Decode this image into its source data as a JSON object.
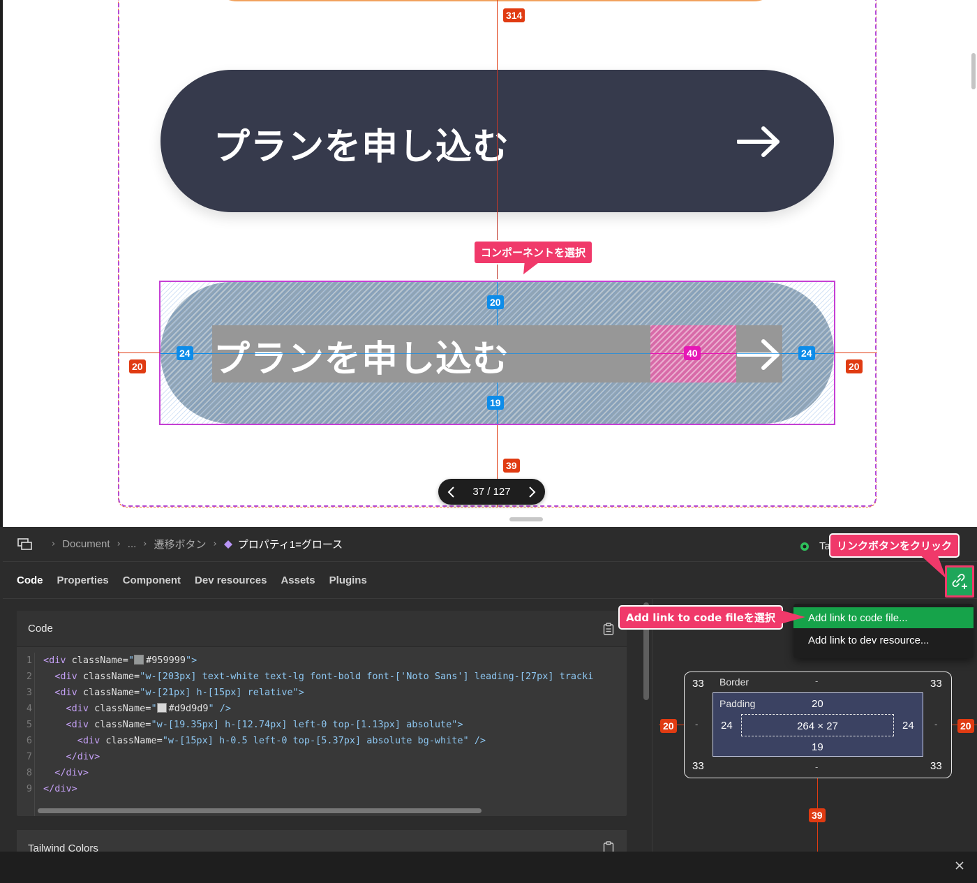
{
  "canvas": {
    "button_label": "プランを申し込む",
    "callout_select": "コンポーネントを選択",
    "pager": {
      "text": "37 / 127"
    },
    "measures": {
      "top_spacing": "314",
      "bottom_spacing": "39",
      "left_spacing": "20",
      "right_spacing": "20",
      "pad_top": "20",
      "pad_bottom": "19",
      "pad_left": "24",
      "pad_right": "24",
      "gap": "40"
    }
  },
  "breadcrumb": {
    "items": [
      "Document",
      "...",
      "遷移ボタン"
    ],
    "current": "プロパティ1=グロース",
    "right_label": "Ta"
  },
  "tabs": [
    "Code",
    "Properties",
    "Component",
    "Dev resources",
    "Assets",
    "Plugins"
  ],
  "code_panel": {
    "title": "Code",
    "lines": [
      {
        "n": "1",
        "indent": "",
        "tag": "<div ",
        "attr": "className=",
        "value": "\"",
        "swatch": "#959999",
        "swatch_text": "#959999",
        "rest": "\">"
      },
      {
        "n": "2",
        "indent": "  ",
        "tag": "<div ",
        "attr": "className=",
        "value": "\"w-[203px] text-white text-lg font-bold font-['Noto Sans'] leading-[27px] tracki",
        "rest": ""
      },
      {
        "n": "3",
        "indent": "  ",
        "tag": "<div ",
        "attr": "className=",
        "value": "\"w-[21px] h-[15px] relative\">",
        "rest": ""
      },
      {
        "n": "4",
        "indent": "    ",
        "tag": "<div ",
        "attr": "className=",
        "value": "\"",
        "swatch": "#d9d9d9",
        "swatch_text": "#d9d9d9",
        "rest": "\" />"
      },
      {
        "n": "5",
        "indent": "    ",
        "tag": "<div ",
        "attr": "className=",
        "value": "\"w-[19.35px] h-[12.74px] left-0 top-[1.13px] absolute\">",
        "rest": ""
      },
      {
        "n": "6",
        "indent": "      ",
        "tag": "<div ",
        "attr": "className=",
        "value": "\"w-[15px] h-0.5 left-0 top-[5.37px] absolute bg-white\" />",
        "rest": ""
      },
      {
        "n": "7",
        "indent": "    ",
        "tag": "</div>",
        "attr": "",
        "value": "",
        "rest": ""
      },
      {
        "n": "8",
        "indent": "  ",
        "tag": "</div>",
        "attr": "",
        "value": "",
        "rest": ""
      },
      {
        "n": "9",
        "indent": "",
        "tag": "</div>",
        "attr": "",
        "value": "",
        "rest": ""
      }
    ]
  },
  "tailwind_panel": {
    "title": "Tailwind Colors"
  },
  "dropdown": {
    "items": [
      "Add link to code file...",
      "Add link to dev resource..."
    ]
  },
  "callouts": {
    "link_button": "リンクボタンをクリック",
    "add_link": "Add link to code fileを選択"
  },
  "box_model": {
    "border_label": "Border",
    "padding_label": "Padding",
    "border_top_left": "33",
    "border_top_right": "33",
    "border_bottom_left": "33",
    "border_bottom_right": "33",
    "border_dash": "-",
    "padding_top": "20",
    "padding_bottom": "19",
    "padding_left": "24",
    "padding_right": "24",
    "content_size": "264 × 27",
    "margin_left": "20",
    "margin_right": "20",
    "margin_bottom": "39"
  },
  "colors": {
    "accent_pink": "#f0396a",
    "measure_orange": "#e03b12",
    "measure_blue": "#0d8ce9",
    "gap_pink": "#e617b6",
    "button_dark": "#363a4c",
    "highlight_green": "#16a34a"
  }
}
